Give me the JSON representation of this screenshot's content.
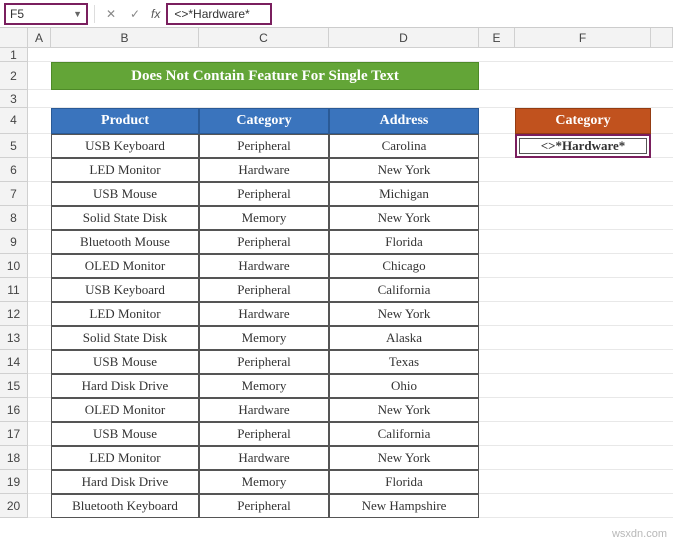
{
  "name_box": "F5",
  "formula": "<>*Hardware*",
  "columns": [
    "A",
    "B",
    "C",
    "D",
    "E",
    "F"
  ],
  "title": "Does Not Contain Feature For Single Text",
  "headers": {
    "product": "Product",
    "category": "Category",
    "address": "Address"
  },
  "criteria_header": "Category",
  "criteria_value": "<>*Hardware*",
  "rows": [
    {
      "product": "USB Keyboard",
      "category": "Peripheral",
      "address": "Carolina"
    },
    {
      "product": "LED Monitor",
      "category": "Hardware",
      "address": "New York"
    },
    {
      "product": "USB Mouse",
      "category": "Peripheral",
      "address": "Michigan"
    },
    {
      "product": "Solid State Disk",
      "category": "Memory",
      "address": "New York"
    },
    {
      "product": "Bluetooth Mouse",
      "category": "Peripheral",
      "address": "Florida"
    },
    {
      "product": "OLED Monitor",
      "category": "Hardware",
      "address": "Chicago"
    },
    {
      "product": "USB Keyboard",
      "category": "Peripheral",
      "address": "California"
    },
    {
      "product": "LED Monitor",
      "category": "Hardware",
      "address": "New York"
    },
    {
      "product": "Solid State Disk",
      "category": "Memory",
      "address": "Alaska"
    },
    {
      "product": "USB Mouse",
      "category": "Peripheral",
      "address": "Texas"
    },
    {
      "product": "Hard Disk Drive",
      "category": "Memory",
      "address": "Ohio"
    },
    {
      "product": "OLED Monitor",
      "category": "Hardware",
      "address": "New York"
    },
    {
      "product": "USB Mouse",
      "category": "Peripheral",
      "address": "California"
    },
    {
      "product": "LED Monitor",
      "category": "Hardware",
      "address": "New York"
    },
    {
      "product": "Hard Disk Drive",
      "category": "Memory",
      "address": "Florida"
    },
    {
      "product": "Bluetooth Keyboard",
      "category": "Peripheral",
      "address": "New Hampshire"
    }
  ],
  "watermark": "wsxdn.com",
  "chart_data": {
    "type": "table",
    "title": "Does Not Contain Feature For Single Text",
    "columns": [
      "Product",
      "Category",
      "Address"
    ],
    "data": [
      [
        "USB Keyboard",
        "Peripheral",
        "Carolina"
      ],
      [
        "LED Monitor",
        "Hardware",
        "New York"
      ],
      [
        "USB Mouse",
        "Peripheral",
        "Michigan"
      ],
      [
        "Solid State Disk",
        "Memory",
        "New York"
      ],
      [
        "Bluetooth Mouse",
        "Peripheral",
        "Florida"
      ],
      [
        "OLED Monitor",
        "Hardware",
        "Chicago"
      ],
      [
        "USB Keyboard",
        "Peripheral",
        "California"
      ],
      [
        "LED Monitor",
        "Hardware",
        "New York"
      ],
      [
        "Solid State Disk",
        "Memory",
        "Alaska"
      ],
      [
        "USB Mouse",
        "Peripheral",
        "Texas"
      ],
      [
        "Hard Disk Drive",
        "Memory",
        "Ohio"
      ],
      [
        "OLED Monitor",
        "Hardware",
        "New York"
      ],
      [
        "USB Mouse",
        "Peripheral",
        "California"
      ],
      [
        "LED Monitor",
        "Hardware",
        "New York"
      ],
      [
        "Hard Disk Drive",
        "Memory",
        "Florida"
      ],
      [
        "Bluetooth Keyboard",
        "Peripheral",
        "New Hampshire"
      ]
    ],
    "criteria": {
      "Category": "<>*Hardware*"
    }
  }
}
